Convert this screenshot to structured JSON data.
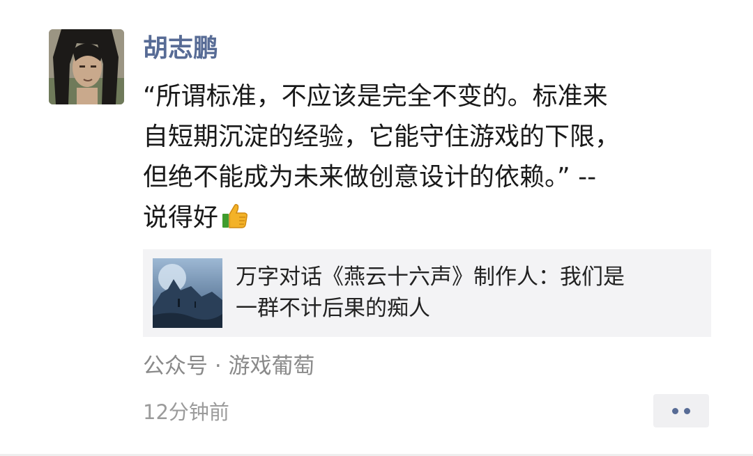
{
  "post": {
    "author": "胡志鹏",
    "text_lines": [
      "“所谓标准，不应该是完全不变的。标准来",
      "自短期沉淀的经验，它能守住游戏的下限，",
      "但绝不能成为未来做创意设计的依赖。” --",
      "说得好"
    ],
    "emoji": "thumbs-up-icon",
    "share": {
      "title_lines": [
        "万字对话《燕云十六声》制作人：我们是",
        "一群不计后果的痴人"
      ]
    },
    "source": "公众号 · 游戏葡萄",
    "time": "12分钟前"
  },
  "colors": {
    "author_name": "#576b95",
    "body_text": "#191919",
    "meta_text": "#8a8a8a",
    "share_bg": "#f3f3f5"
  }
}
